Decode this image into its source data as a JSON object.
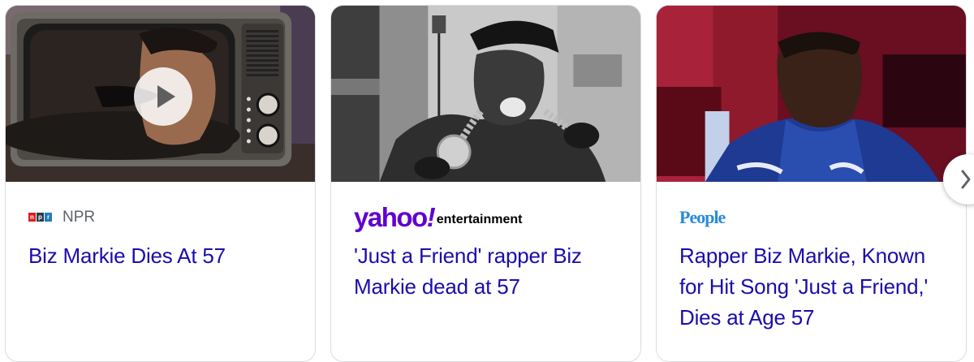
{
  "cards": [
    {
      "source": "NPR",
      "source_logo": "npr-logo",
      "npr_letters": [
        "n",
        "p",
        "r"
      ],
      "npr_colors": [
        "#d62021",
        "#2a3a4d",
        "#237bbd"
      ],
      "headline": "Biz Markie Dies At 57",
      "has_video": true
    },
    {
      "source_logo": "yahoo-entertainment-logo",
      "logo_word": "yahoo",
      "logo_mark": "!",
      "logo_sub": "entertainment",
      "headline": "'Just a Friend' rapper Biz Markie dead at 57"
    },
    {
      "source_logo": "people-logo",
      "logo_text": "People",
      "headline": "Rapper Biz Markie, Known for Hit Song 'Just a Friend,' Dies at Age 57"
    }
  ],
  "icons": {
    "play": "play-icon",
    "next": "chevron-right-icon"
  },
  "colors": {
    "link": "#1a0dab",
    "source_text": "#5f6368",
    "yahoo": "#6001d2",
    "people": "#2a8ad8",
    "border": "#dadce0"
  }
}
